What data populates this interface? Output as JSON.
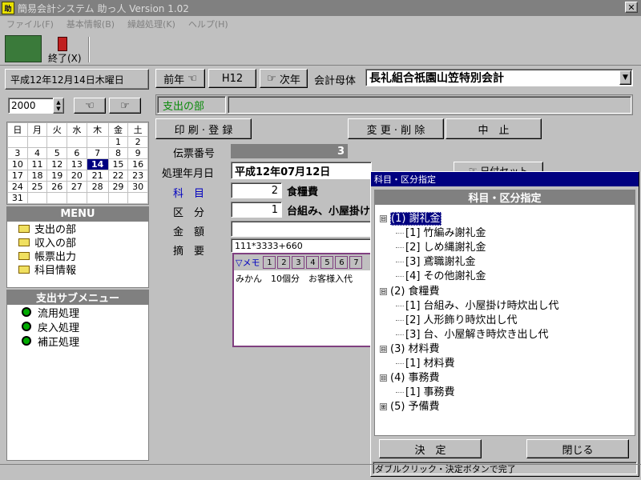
{
  "window": {
    "title": "簡易会計システム 助っ人 Version 1.02",
    "app_icon": "助",
    "close": "✕"
  },
  "menu": [
    "ファイル(F)",
    "基本情報(B)",
    "繰越処理(K)",
    "ヘルプ(H)"
  ],
  "toolbar": {
    "exit_label": "終了(X)"
  },
  "left": {
    "date_label": "平成12年12月14日木曜日",
    "year": "2000",
    "calendar": {
      "headers": [
        "日",
        "月",
        "火",
        "水",
        "木",
        "金",
        "土"
      ],
      "weeks": [
        [
          "",
          "",
          "",
          "",
          "",
          "1",
          "2"
        ],
        [
          "3",
          "4",
          "5",
          "6",
          "7",
          "8",
          "9"
        ],
        [
          "10",
          "11",
          "12",
          "13",
          "14",
          "15",
          "16"
        ],
        [
          "17",
          "18",
          "19",
          "20",
          "21",
          "22",
          "23"
        ],
        [
          "24",
          "25",
          "26",
          "27",
          "28",
          "29",
          "30"
        ],
        [
          "31",
          "",
          "",
          "",
          "",
          "",
          ""
        ]
      ],
      "selected": "14"
    },
    "menu_title": "MENU",
    "menu_items": [
      "支出の部",
      "収入の部",
      "帳票出力",
      "科目情報"
    ],
    "sub_title": "支出サブメニュー",
    "sub_items": [
      "流用処理",
      "戻入処理",
      "補正処理"
    ]
  },
  "top": {
    "prev_year": "前年",
    "current_year": "H12",
    "next_year": "次年",
    "org_label": "会計母体",
    "org_value": "長礼組合祇園山笠特別会計"
  },
  "section_title": "支出の部",
  "actions": {
    "print": "印 刷 · 登 録",
    "edit": "変 更 · 削 除",
    "cancel": "中　止",
    "date_set": "日付セット"
  },
  "form": {
    "slip_label": "伝票番号",
    "slip_value": "3",
    "date_label": "処理年月日",
    "date_value": "平成12年07月12日",
    "subject_label": "科　目",
    "subject_code": "2",
    "subject_name": "食糧費",
    "category_label": "区　分",
    "category_code": "1",
    "category_name": "台組み、小屋掛け",
    "amount_label": "金　額",
    "memo_label": "摘　要",
    "memo_value": "111*3333+660",
    "memo_tab": "▽メモ",
    "memo_numbers": [
      "1",
      "2",
      "3",
      "4",
      "5",
      "6",
      "7"
    ],
    "memo_text": "みかん　10個分　お客様入代"
  },
  "dialog": {
    "title": "科目・区分指定",
    "header": "科目・区分指定",
    "tree": [
      {
        "sym": "⊟",
        "label": "(1) 謝礼金",
        "depth": 0,
        "selected": true
      },
      {
        "sym": "",
        "label": "[1] 竹編み謝礼金",
        "depth": 1
      },
      {
        "sym": "",
        "label": "[2] しめ縄謝礼金",
        "depth": 1
      },
      {
        "sym": "",
        "label": "[3] 鳶職謝礼金",
        "depth": 1
      },
      {
        "sym": "",
        "label": "[4] その他謝礼金",
        "depth": 1
      },
      {
        "sym": "⊟",
        "label": "(2) 食糧費",
        "depth": 0
      },
      {
        "sym": "",
        "label": "[1] 台組み、小屋掛け時炊出し代",
        "depth": 1
      },
      {
        "sym": "",
        "label": "[2] 人形飾り時炊出し代",
        "depth": 1
      },
      {
        "sym": "",
        "label": "[3] 台、小屋解き時炊き出し代",
        "depth": 1
      },
      {
        "sym": "⊟",
        "label": "(3) 材料費",
        "depth": 0
      },
      {
        "sym": "",
        "label": "[1] 材料費",
        "depth": 1
      },
      {
        "sym": "⊟",
        "label": "(4) 事務費",
        "depth": 0
      },
      {
        "sym": "",
        "label": "[1] 事務費",
        "depth": 1
      },
      {
        "sym": "⊞",
        "label": "(5) 予備費",
        "depth": 0
      }
    ],
    "ok": "決　定",
    "close": "閉じる",
    "hint": "ダブルクリック・決定ボタンで完了"
  }
}
